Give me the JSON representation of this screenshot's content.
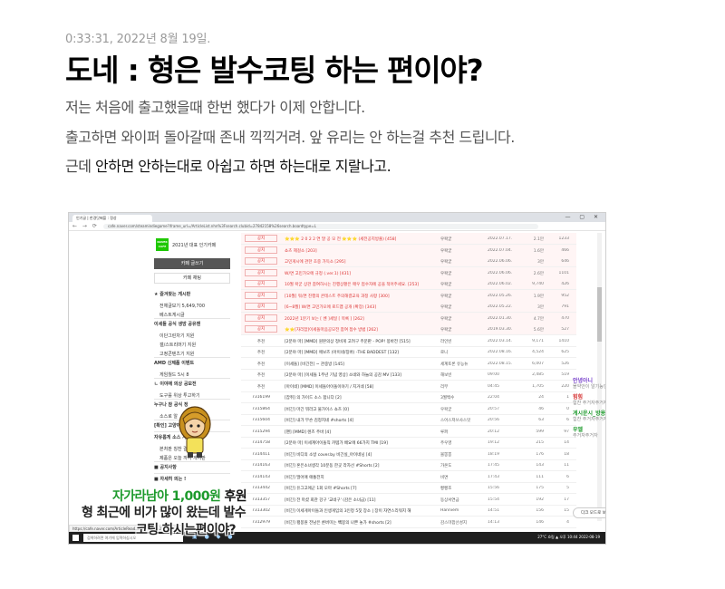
{
  "header": {
    "timestamp": "0:33:31, 2022년 8월 19일.",
    "headline": "도네 : 형은 발수코팅 하는 편이야?"
  },
  "body": {
    "line1": "저는 처음에 출고했을때 한번 했다가 이제 안합니다.",
    "line2": "출고하면 와이퍼 돌아갈때 존내 끽끽거려. 앞 유리는 안 하는걸 추천 드립니다.",
    "line3_a": "근데 ",
    "line3_b": "안하면 안하는대로 아쉽고 하면 하는대로 지랄나고."
  },
  "screenshot": {
    "tab_label": "인기글 | 한경닷쩌플 : 정성",
    "url": "cafe.naver.com/steamindiegame?iframe_url=/ArticleList.nhn%3Fsearch.clubid=27842158%26search.boardtype=L",
    "cafe_name": "2021년 대표 인기카페",
    "write_button": "카페 글쓰기",
    "chat_button": "카페 채팅",
    "sidebar": [
      {
        "label": "★ 즐겨찾는 게시판",
        "bold": true
      },
      {
        "label": "전체글보기  5,649,700",
        "bold": false
      },
      {
        "label": "베스트게시글",
        "bold": false
      },
      {
        "label": "이세돌 공식 생방 공유맨",
        "bold": true
      },
      {
        "label": "이단그린차기 지원",
        "bold": false
      },
      {
        "label": "갤/스트리머기 지원",
        "bold": false
      },
      {
        "label": "고정콘텐츠기 지원",
        "bold": false
      },
      {
        "label": "AMD 신제품 이벤트",
        "bold": true
      },
      {
        "label": "게임월드 5시 8",
        "bold": false
      },
      {
        "label": "ㄴ 이야애 의상 공모전",
        "bold": true
      },
      {
        "label": "도구를 위상 투고하기",
        "bold": false
      },
      {
        "label": "누구나 참 공식 정",
        "bold": true
      },
      {
        "label": "소스로 알",
        "bold": false
      },
      {
        "label": "[확인] 고양아 정보",
        "bold": true
      },
      {
        "label": "자유롭게 소스 사",
        "bold": true
      },
      {
        "label": "본처판 칭찬 결합 참고",
        "bold": false
      },
      {
        "label": "제품은 오늘 까지 게시판",
        "bold": false
      },
      {
        "label": "■ 공지사항",
        "bold": true
      },
      {
        "label": "■ 자세히 의는 !",
        "bold": true
      }
    ],
    "rows": [
      {
        "num": "공지",
        "title": "⭐⭐⭐ 2 0 2 2 연 말 공 모 전 ⭐⭐⭐ (세전공지방출) [458]",
        "author": "우왁굳",
        "date": "2022.07.17.",
        "views": "2.1만",
        "likes": "1233",
        "notice": true
      },
      {
        "num": "공지",
        "title": "쇼츠 제걸소 [203]",
        "author": "우왁굳",
        "date": "2022.07.04.",
        "views": "1.6만",
        "likes": "466",
        "notice": true
      },
      {
        "num": "공지",
        "title": "고민게시에 관한 초중 가득소 [295]",
        "author": "우왁굳",
        "date": "2022.06.06.",
        "views": "3만",
        "likes": "646",
        "notice": true
      },
      {
        "num": "공지",
        "title": "W/면 고민가오에 규정 (.ver.1) [431]",
        "author": "우왁굳",
        "date": "2022.06.06.",
        "views": "2.6만",
        "likes": "1101",
        "notice": true
      },
      {
        "num": "공지",
        "title": "10월 왁굳 상관 참여하시는 진행상황은 매우 접수자에 공을 적어주세요. [253]",
        "author": "우왁굳",
        "date": "2022.06.02.",
        "views": "9,740",
        "likes": "426",
        "notice": true
      },
      {
        "num": "공지",
        "title": "[10월] 워/면 진행의 콘테스트 주의해결교육 과정 사항 [300]",
        "author": "우왁굳",
        "date": "2022.05.26.",
        "views": "1.9만",
        "likes": "952",
        "notice": true
      },
      {
        "num": "공지",
        "title": "[6~8월] W/면 고민가오에 로드맵 공개 (확장) [343]",
        "author": "우왁굳",
        "date": "2022.05.22.",
        "views": "3만",
        "likes": "791",
        "notice": true
      },
      {
        "num": "공지",
        "title": "2022년 1분기 보는 [ 벤 ]세일 [ 목록 ] [262]",
        "author": "우왁굳",
        "date": "2022.01.30.",
        "views": "4.7만",
        "likes": "470",
        "notice": true
      },
      {
        "num": "공지",
        "title": "⭐⭐[자리잡]이세돌마음공모전 참여 접수 방법 [262]",
        "author": "우왁굳",
        "date": "2019.03.30.",
        "views": "5.6만",
        "likes": "527",
        "notice": true
      },
      {
        "num": "추천",
        "title": "[2분야 마] [MMD] 원본의상 정비게 고려구 주문판 - POP! 몽바전 [515]",
        "author": "라인빈",
        "date": "2022.03.14.",
        "views": "9,171",
        "likes": "1410",
        "notice": false
      },
      {
        "num": "추천",
        "title": "[2분야 마] [MMD] 에보즈 (아이네/징버) -THE BADDEST [132]",
        "author": "로니",
        "date": "2022.08.16.",
        "views": "4,524",
        "likes": "625",
        "notice": false
      },
      {
        "num": "추천",
        "title": "[이세돌] [비긴전] ~ 관중방 [145]",
        "author": "세계토론 유능뉴",
        "date": "2022.08.15.",
        "views": "6,007",
        "likes": "526",
        "notice": false
      },
      {
        "num": "추천",
        "title": "[2분야 마] [이세돌 1주년 기념 영상] 소네와 하늘의 공감 MV [133]",
        "author": "해보빈",
        "date": "09:00",
        "views": "2,485",
        "likes": "519",
        "notice": false
      },
      {
        "num": "추천",
        "title": "[아이네] [MMD] 이세돌아이돌이야기 / 지거네 [58]",
        "author": "리부",
        "date": "04:45",
        "views": "1,705",
        "likes": "220",
        "notice": false
      },
      {
        "num": "7316199",
        "title": "[잡쥐] 의 가이드 소스 합니다 [2]",
        "author": "3월백수",
        "date": "22:04",
        "views": "24",
        "likes": "1",
        "notice": false
      },
      {
        "num": "7315864",
        "title": "[비긴] 마긴 뭐라고 물가이스 쇼츠 [0]",
        "author": "우왁굳",
        "date": "20:57",
        "views": "46",
        "likes": "0",
        "notice": false
      },
      {
        "num": "7315604",
        "title": "[비긴] 내가 무슨 김정지네 #shorts [4]",
        "author": "스어스저쓰사스잇",
        "date": "20:56",
        "views": "63",
        "likes": "6",
        "notice": false
      },
      {
        "num": "7315294",
        "title": "[팬] [MMD] 렌즈 주바 [4]",
        "author": "루퍼",
        "date": "20:12",
        "views": "599",
        "likes": "97",
        "notice": false
      },
      {
        "num": "7314758",
        "title": "[2분야 마] 이세계아이돌직 카템가 배요에 66가지 TMI [19]",
        "author": "주우영",
        "date": "19:12",
        "views": "215",
        "likes": "14",
        "notice": false
      },
      {
        "num": "7314411",
        "title": "[비긴] 비디의 소방 cover.by 비긴실_아이네닝 [4]",
        "author": "볼뽕뽕",
        "date": "18:19",
        "views": "176",
        "likes": "18",
        "notice": false
      },
      {
        "num": "7314163",
        "title": "[비긴] 혼은소녀생각 10분동 한곳 라자선 #Shorts [2]",
        "author": "가온도",
        "date": "17:45",
        "views": "143",
        "likes": "11",
        "notice": false
      },
      {
        "num": "7314143",
        "title": "[비긴] 떨어애 애통전지",
        "author": "비면",
        "date": "17:43",
        "views": "111",
        "likes": "6",
        "notice": false
      },
      {
        "num": "7313442",
        "title": "[비긴] 유그고에군 1회 오마 #Shorts [7]",
        "author": "빵빵조",
        "date": "15:56",
        "views": "175",
        "likes": "5",
        "notice": false
      },
      {
        "num": "7313357",
        "title": "[비긴] 전 마셨 회관 강구 '교네구' (감은 소녀금) [11]",
        "author": "동상서연금",
        "date": "15:54",
        "views": "192",
        "likes": "17",
        "notice": false
      },
      {
        "num": "7313302",
        "title": "[비긴] 이세게아이돌과 인생게임의 3인정 5짓 장소 | 장이 자연스리워지 해",
        "author": "Hanniem",
        "date": "14:51",
        "views": "156",
        "likes": "15",
        "notice": false
      },
      {
        "num": "7312979",
        "title": "[비긴] 팽봉원 전남은 룬버미는 빽봉의 나쁜 놓가 #shorts [2]",
        "author": "감스마팜선성지",
        "date": "14:13",
        "views": "146",
        "likes": "4",
        "notice": false
      }
    ],
    "chat_overlays": [
      {
        "text": "안녕아니",
        "color": "#7a44cc"
      },
      {
        "text": "몰약안이 알기능인튼",
        "color": "#888888"
      },
      {
        "text": "힘힘",
        "color": "#d43030"
      },
      {
        "text": "힘찬 주거자주거자···",
        "color": "#888888"
      },
      {
        "text": "게시운시_방용",
        "color": "#1d9a2c"
      },
      {
        "text": "힘찬 주거자주거자···",
        "color": "#888888"
      },
      {
        "text": "우엘",
        "color": "#1d9a2c"
      },
      {
        "text": "주거자주거자",
        "color": "#888888"
      }
    ],
    "dark_mode_label": "다크 모드로 보기",
    "status_url": "https://cafe.naver.com/ArticleRead.nhn?clubid=27842158...",
    "taskbar_search": "검색하려면 여기에 입력하십시오",
    "tray_text": "27°C 흐림 ▲ 오후 10:44 2022-08-19"
  },
  "captions": {
    "line1_hl": "자가라남아 1,000원",
    "line1_rest": " 후원",
    "line2": "형 최근에 비가 많이 왔는데 발수",
    "line3": "코팅 하시는편이야?"
  },
  "colors": {
    "headline": "#000000",
    "body": "#555555",
    "timestamp": "#9a9a9a",
    "caption_highlight": "#1d9a2c",
    "notice_red": "#d33333"
  }
}
